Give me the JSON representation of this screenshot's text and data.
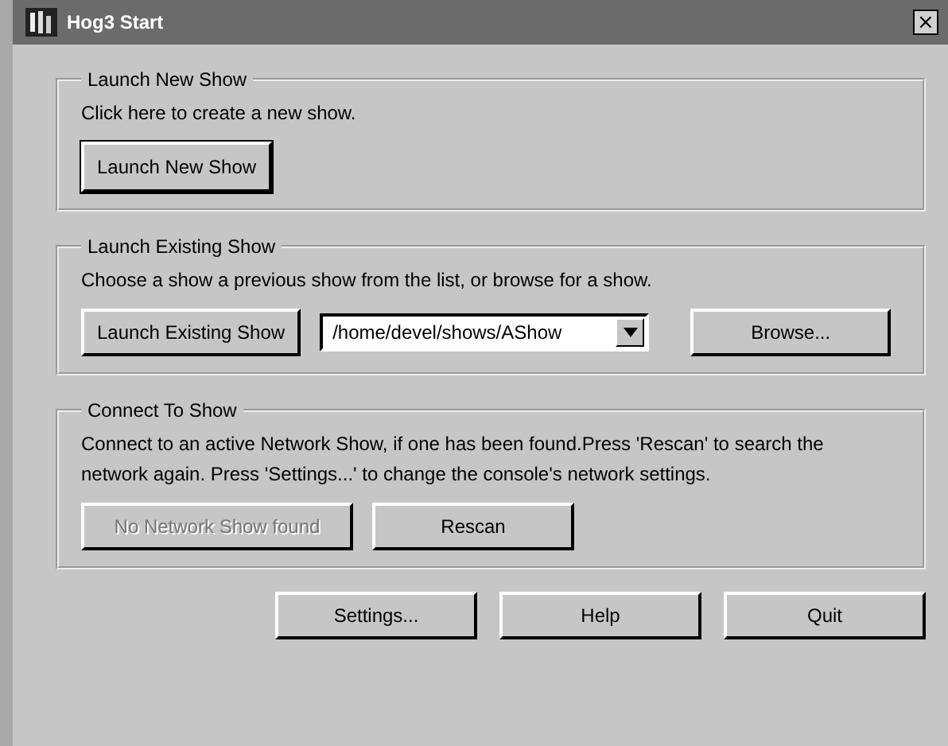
{
  "window": {
    "title": "Hog3 Start",
    "close": "×"
  },
  "groups": [
    {
      "title": "Launch New Show",
      "description": "Click here to create a new show.",
      "controls": [
        {
          "kind": "button",
          "label": "Launch New Show",
          "default": true,
          "disabled": false
        }
      ]
    },
    {
      "title": "Launch Existing Show",
      "description": "Choose a show a previous show from the list, or browse for a show.",
      "controls": [
        {
          "kind": "button",
          "label": "Launch Existing Show",
          "default": false,
          "disabled": false
        },
        {
          "kind": "dropdown",
          "value": "/home/devel/shows/AShow"
        },
        {
          "kind": "button",
          "label": "Browse...",
          "default": false,
          "disabled": false
        }
      ]
    },
    {
      "title": "Connect To Show",
      "description": "Connect to an active Network Show, if one has been found.Press 'Rescan' to search the network again.  Press 'Settings...' to change the console's network settings.",
      "controls": [
        {
          "kind": "button",
          "label": "No Network Show found",
          "default": false,
          "disabled": true
        },
        {
          "kind": "button",
          "label": "Rescan",
          "default": false,
          "disabled": false
        }
      ]
    }
  ],
  "buttons": [
    "Settings...",
    "Help",
    "Quit"
  ]
}
